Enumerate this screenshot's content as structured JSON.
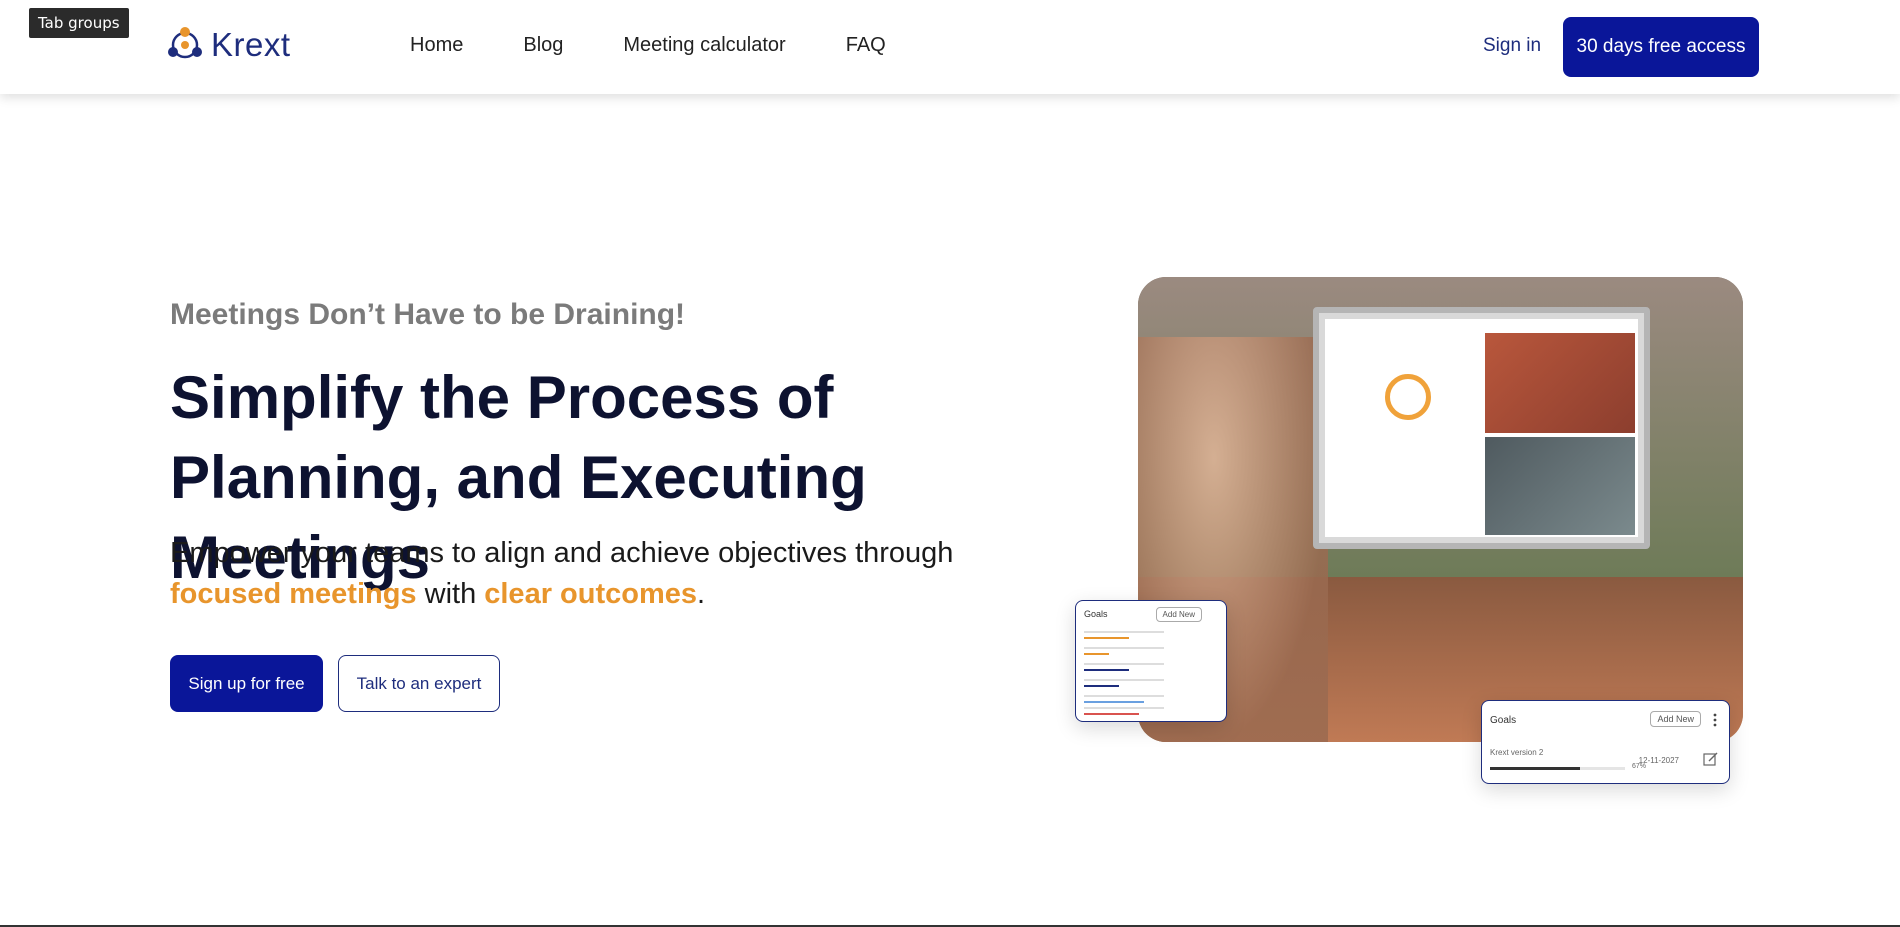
{
  "browser": {
    "tab_groups_label": "Tab groups"
  },
  "header": {
    "logo_text": "Krext",
    "nav": [
      "Home",
      "Blog",
      "Meeting calculator",
      "FAQ"
    ],
    "signin_label": "Sign in",
    "cta_label": "30 days free access"
  },
  "hero": {
    "eyebrow": "Meetings Don’t Have to be Draining!",
    "title": "Simplify the Process of Planning, and Executing Meetings",
    "sub_pre": "Empower your teams to align and achieve objectives through ",
    "highlight1": "focused meetings",
    "sub_mid": " with ",
    "highlight2": "clear outcomes",
    "sub_end": ".",
    "primary_button": "Sign up for free",
    "secondary_button": "Talk to an expert"
  },
  "cards": {
    "left": {
      "title": "Goals",
      "button": "Add New"
    },
    "right": {
      "title": "Goals",
      "button": "Add New",
      "item": "Krext version 2",
      "date": "12-11-2027",
      "progress_label": "67%",
      "progress": 0.67
    }
  },
  "colors": {
    "brand": "#0a1699",
    "accent": "#e8952c",
    "text": "#0d1230"
  }
}
